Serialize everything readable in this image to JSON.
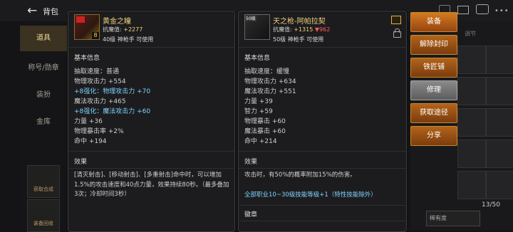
{
  "window": {
    "title": "背包",
    "top_status": "战斗力 ..."
  },
  "left_nav": {
    "items": [
      {
        "label": "道具",
        "active": true
      },
      {
        "label": "称号/勋章",
        "active": false
      },
      {
        "label": "装扮",
        "active": false
      },
      {
        "label": "金库",
        "active": false
      }
    ],
    "bottom": [
      {
        "label": "获取合成"
      },
      {
        "label": "装备回收"
      }
    ]
  },
  "right_grid": {
    "header": "调节",
    "count": "13/50",
    "sort_label": "稀有度"
  },
  "item1": {
    "name": "黄金之瞳",
    "stat_label": "抗魔值",
    "stat_value": "+2277",
    "requirement": "40级 神枪手 可使用",
    "badge": "8",
    "basic_head": "基本信息",
    "lines": [
      {
        "text": "抽取速度：普通",
        "style": "normal"
      },
      {
        "text": "物理攻击力 +554",
        "style": "normal"
      },
      {
        "text": "+8强化：物理攻击力 +70",
        "style": "blue"
      },
      {
        "text": "魔法攻击力 +465",
        "style": "normal"
      },
      {
        "text": "+8强化：魔法攻击力 +60",
        "style": "blue"
      },
      {
        "text": "力量 +36",
        "style": "normal"
      },
      {
        "text": "物理暴击率 +2%",
        "style": "normal"
      },
      {
        "text": "命中 +194",
        "style": "normal"
      }
    ],
    "effect_head": "效果",
    "effect_text": "[清灭射击]、[移动射击]、[多重射击]命中时，可以增加1.5%的攻击速度和40点力量，效果持续80秒。（最多叠加3次；冷却时间3秒）"
  },
  "item2": {
    "name": "天之枪-阿帕拉契",
    "stat_label": "抗魔值",
    "stat_value": "+1315",
    "stat_delta": "▼962",
    "requirement": "50级 神枪手 可使用",
    "level_tag": "50级",
    "basic_head": "基本信息",
    "lines": [
      {
        "text": "抽取速度：缓慢"
      },
      {
        "text": "物理攻击力 +634"
      },
      {
        "text": "魔法攻击力 +551"
      },
      {
        "text": "力量 +39"
      },
      {
        "text": "智力 +59"
      },
      {
        "text": "物理暴击 +60"
      },
      {
        "text": "魔法暴击 +60"
      },
      {
        "text": "命中 +214"
      }
    ],
    "effect_head": "效果",
    "effect_text": "攻击时，有50%的概率附加15%的伤害。",
    "skill_line": "全部职业10~30级技能等级+1（特性技能除外）",
    "emblem_head": "徽章"
  },
  "actions": [
    {
      "label": "装备",
      "style": "primary"
    },
    {
      "label": "解除封印",
      "style": "normal"
    },
    {
      "label": "铁匠铺",
      "style": "normal"
    },
    {
      "label": "修理",
      "style": "gray"
    },
    {
      "label": "获取途径",
      "style": "normal"
    },
    {
      "label": "分享",
      "style": "normal"
    }
  ],
  "colors": {
    "gold": "#f0d17a",
    "blue": "#7fd2ff",
    "red": "#ff5a5a",
    "button": "#b2641a"
  }
}
